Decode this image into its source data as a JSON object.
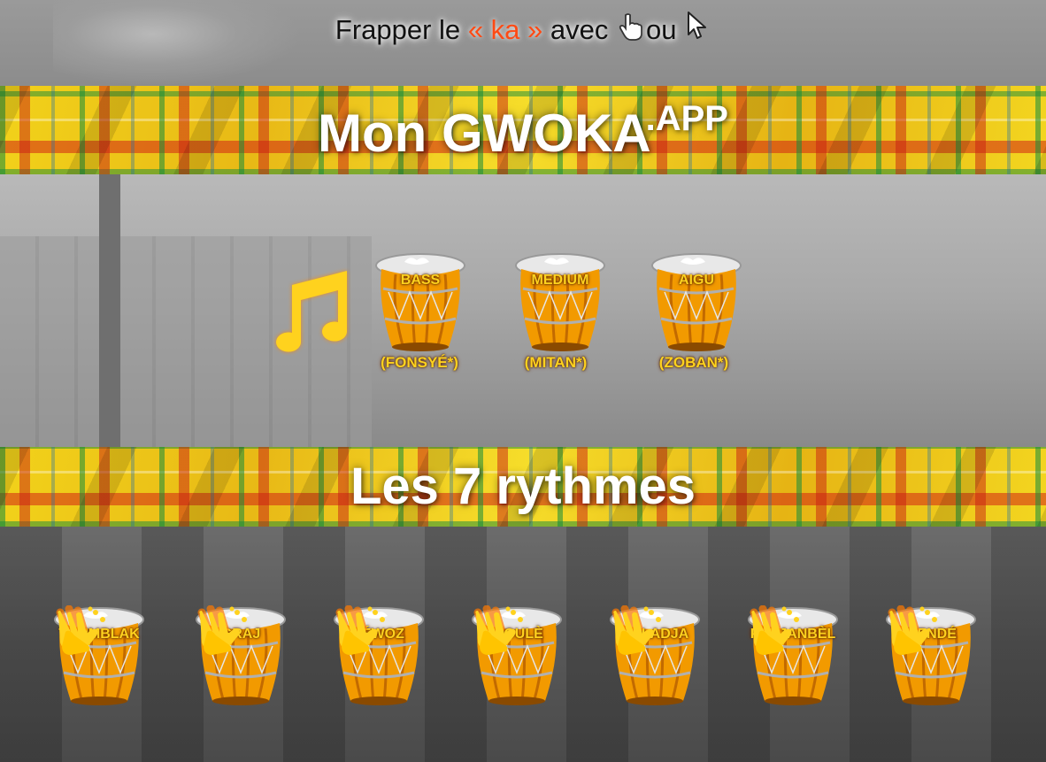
{
  "header": {
    "instruction_prefix": "Frapper le",
    "instruction_ka": "« ka »",
    "instruction_middle": "avec",
    "instruction_or": "ou",
    "touch_icon": "pointing-hand-icon",
    "mouse_icon": "mouse-cursor-icon"
  },
  "app_title": {
    "main": "Mon GWOKA",
    "suffix": ".APP"
  },
  "drums_section": {
    "music_icon": "music-note-icon",
    "drums": [
      {
        "label": "BASS",
        "sub": "(FONSYÉ*)"
      },
      {
        "label": "MEDIUM",
        "sub": "(MITAN*)"
      },
      {
        "label": "AIGU",
        "sub": "(ZOBAN*)"
      }
    ]
  },
  "rhythms_section": {
    "title": "Les 7 rythmes",
    "clap_icon": "clapping-hands-icon",
    "rhythms": [
      "TOUMBLAK",
      "GRAJ",
      "LÉWOZ",
      "WOULÈ",
      "KALADJA",
      "PADJANBÈL",
      "MENDÉ"
    ]
  },
  "colors": {
    "accent": "#ff4a14",
    "label_yellow": "#ffd21e",
    "drum_orange": "#f29a00"
  }
}
